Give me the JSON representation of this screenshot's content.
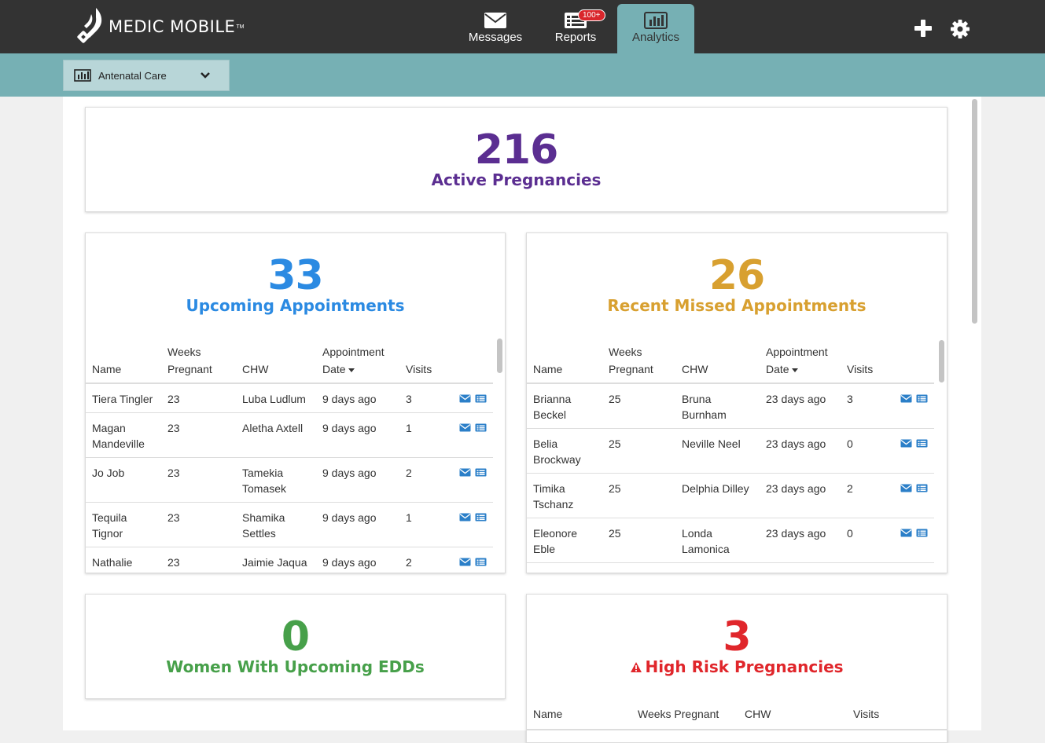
{
  "app": {
    "logo_text": "MEDIC MOBILE",
    "logo_tm": "TM"
  },
  "nav": {
    "messages_label": "Messages",
    "reports_label": "Reports",
    "reports_badge": "100+",
    "analytics_label": "Analytics"
  },
  "toolbar": {
    "add_icon": "plus-icon",
    "settings_icon": "gear-icon"
  },
  "filter": {
    "selected": "Antenatal Care"
  },
  "colors": {
    "purple": "#5b2e91",
    "blue": "#2b8ae2",
    "gold": "#d8a030",
    "green": "#47a04a",
    "red": "#e0262b",
    "teal": "#76b0b4"
  },
  "active_pregnancies": {
    "count": "216",
    "label": "Active Pregnancies"
  },
  "upcoming": {
    "count": "33",
    "label": "Upcoming Appointments",
    "headers": {
      "name": "Name",
      "weeks_1": "Weeks",
      "weeks_2": "Pregnant",
      "chw": "CHW",
      "date_1": "Appointment",
      "date_2": "Date",
      "visits": "Visits"
    },
    "rows": [
      {
        "name1": "Tiera Tingler",
        "name2": "",
        "weeks": "23",
        "chw1": "Luba Ludlum",
        "chw2": "",
        "date": "9 days ago",
        "visits": "3"
      },
      {
        "name1": "Magan",
        "name2": "Mandeville",
        "weeks": "23",
        "chw1": "Aletha Axtell",
        "chw2": "",
        "date": "9 days ago",
        "visits": "1"
      },
      {
        "name1": "Jo Job",
        "name2": "",
        "weeks": "23",
        "chw1": "Tamekia",
        "chw2": "Tomasek",
        "date": "9 days ago",
        "visits": "2"
      },
      {
        "name1": "Tequila",
        "name2": "Tignor",
        "weeks": "23",
        "chw1": "Shamika",
        "chw2": "Settles",
        "date": "9 days ago",
        "visits": "1"
      },
      {
        "name1": "Nathalie",
        "name2": "",
        "weeks": "23",
        "chw1": "Jaimie Jaqua",
        "chw2": "",
        "date": "9 days ago",
        "visits": "2"
      }
    ]
  },
  "missed": {
    "count": "26",
    "label": "Recent Missed Appointments",
    "headers": {
      "name": "Name",
      "weeks_1": "Weeks",
      "weeks_2": "Pregnant",
      "chw": "CHW",
      "date_1": "Appointment",
      "date_2": "Date",
      "visits": "Visits"
    },
    "rows": [
      {
        "name1": "Brianna",
        "name2": "Beckel",
        "weeks": "25",
        "chw1": "Bruna",
        "chw2": "Burnham",
        "date": "23 days ago",
        "visits": "3"
      },
      {
        "name1": "Belia",
        "name2": "Brockway",
        "weeks": "25",
        "chw1": "Neville Neel",
        "chw2": "",
        "date": "23 days ago",
        "visits": "0"
      },
      {
        "name1": "Timika",
        "name2": "Tschanz",
        "weeks": "25",
        "chw1": "Delphia Dilley",
        "chw2": "",
        "date": "23 days ago",
        "visits": "2"
      },
      {
        "name1": "Eleonore",
        "name2": "Eble",
        "weeks": "25",
        "chw1": "Londa",
        "chw2": "Lamonica",
        "date": "23 days ago",
        "visits": "0"
      }
    ]
  },
  "edds": {
    "count": "0",
    "label": "Women With Upcoming EDDs"
  },
  "high_risk": {
    "count": "3",
    "label": "High Risk Pregnancies",
    "headers": {
      "name": "Name",
      "weeks": "Weeks Pregnant",
      "chw": "CHW",
      "visits": "Visits"
    }
  }
}
